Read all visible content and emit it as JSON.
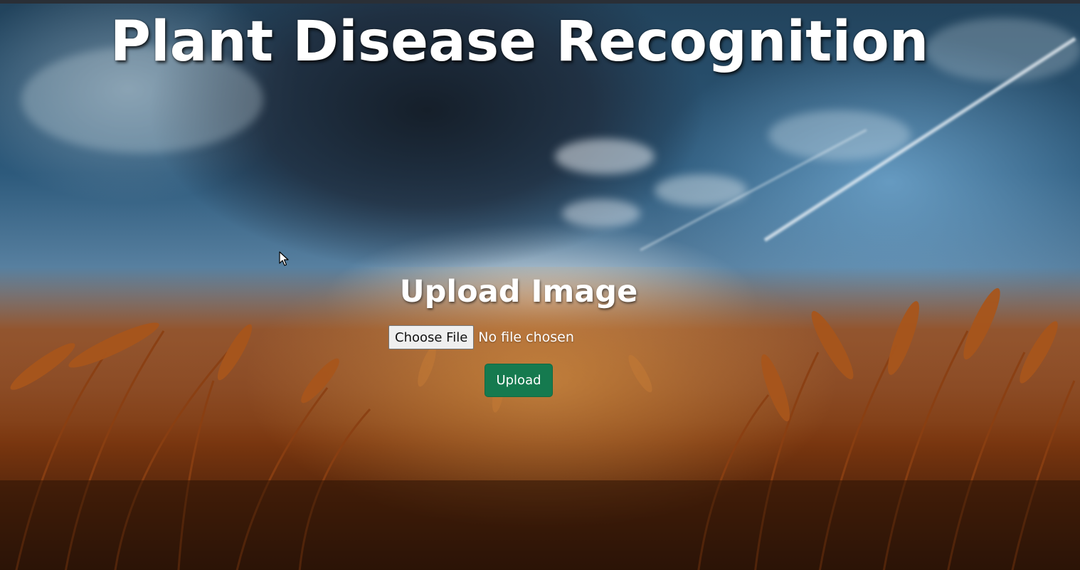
{
  "page": {
    "title": "Plant Disease Recognition"
  },
  "upload": {
    "heading": "Upload Image",
    "choose_file_label": "Choose File",
    "file_status": "No file chosen",
    "submit_label": "Upload"
  },
  "icons": {
    "cursor": "mouse-pointer-icon"
  },
  "colors": {
    "upload_button": "#157a4f",
    "title_text": "#ffffff",
    "choose_file_bg": "#efefef"
  }
}
